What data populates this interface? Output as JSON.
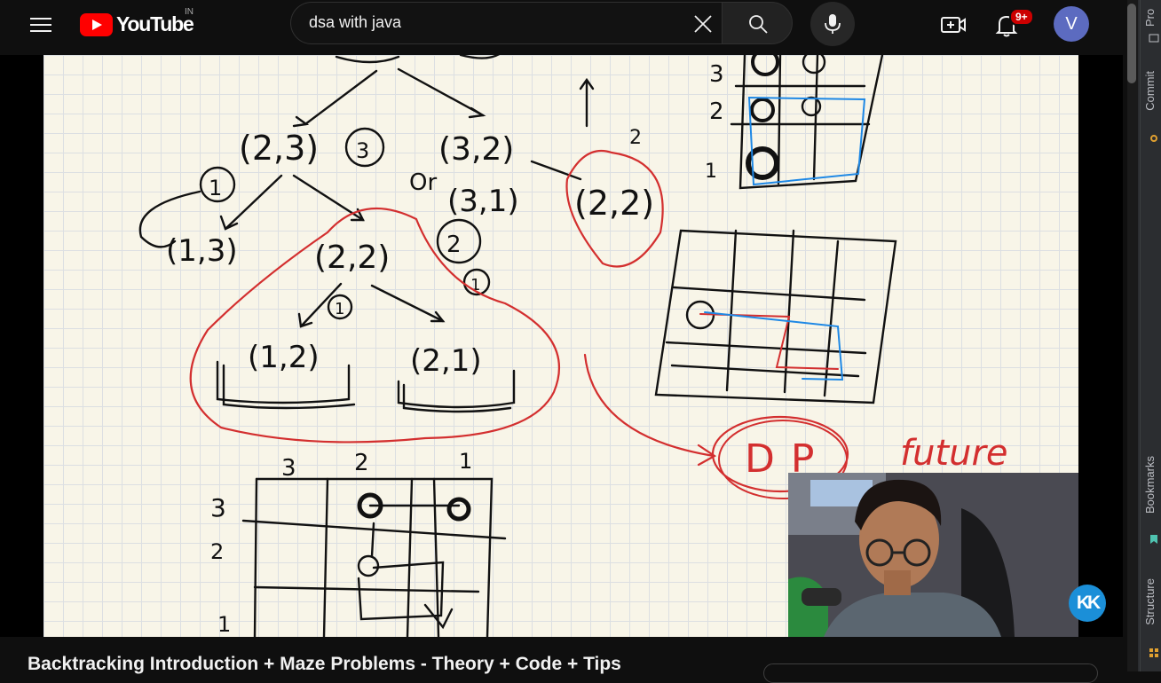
{
  "topbar": {
    "menu_icon": "hamburger-menu-icon",
    "logo_text": "YouTube",
    "country_code": "IN",
    "search_value": "dsa with java",
    "clear_icon": "close-icon",
    "search_icon": "search-icon",
    "mic_icon": "microphone-icon",
    "create_icon": "video-plus-icon",
    "notif_icon": "bell-icon",
    "notif_count": "9+",
    "avatar_letter": "V"
  },
  "ide_strip": {
    "tabs": [
      "Pro",
      "Commit",
      "Bookmarks",
      "Structure"
    ]
  },
  "video": {
    "board": {
      "row_labels": [
        "3",
        "2",
        "1"
      ],
      "col_labels": [
        "3",
        "2",
        "1"
      ],
      "small_labels": [
        "3",
        "2",
        "1"
      ],
      "nodes": [
        "(2,3)",
        "(3,2)",
        "(1,3)",
        "(2,2)",
        "(3,1)",
        "(2,2)",
        "(1,2)",
        "(2,1)"
      ],
      "circled": [
        "3",
        "1",
        "2",
        "1",
        "1"
      ],
      "dp_label": "DP",
      "future_label": "future",
      "or_label": "Or"
    },
    "watermark": "KK"
  },
  "title": "Backtracking Introduction + Maze Problems - Theory + Code + Tips",
  "colors": {
    "brand_red": "#ff0000",
    "badge_red": "#cc0000",
    "avatar_bg": "#5c6bc0",
    "ink_black": "#111111",
    "ink_red": "#d32f2f",
    "ink_blue": "#1e88e5"
  }
}
